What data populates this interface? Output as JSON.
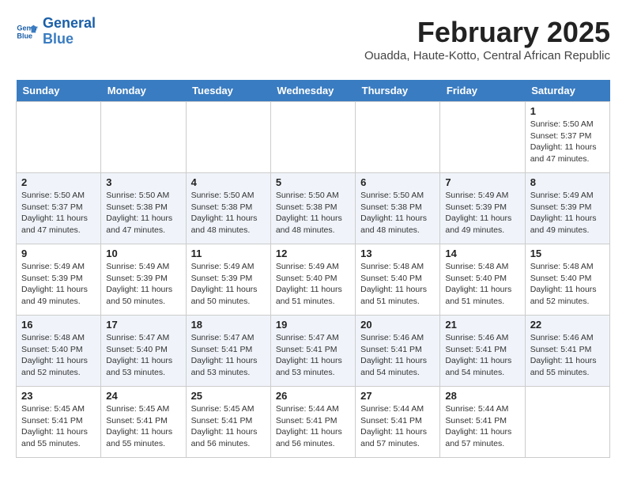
{
  "logo": {
    "line1": "General",
    "line2": "Blue"
  },
  "title": "February 2025",
  "subtitle": "Ouadda, Haute-Kotto, Central African Republic",
  "headers": [
    "Sunday",
    "Monday",
    "Tuesday",
    "Wednesday",
    "Thursday",
    "Friday",
    "Saturday"
  ],
  "weeks": [
    {
      "days": [
        {
          "number": "",
          "info": ""
        },
        {
          "number": "",
          "info": ""
        },
        {
          "number": "",
          "info": ""
        },
        {
          "number": "",
          "info": ""
        },
        {
          "number": "",
          "info": ""
        },
        {
          "number": "",
          "info": ""
        },
        {
          "number": "1",
          "info": "Sunrise: 5:50 AM\nSunset: 5:37 PM\nDaylight: 11 hours\nand 47 minutes."
        }
      ]
    },
    {
      "days": [
        {
          "number": "2",
          "info": "Sunrise: 5:50 AM\nSunset: 5:37 PM\nDaylight: 11 hours\nand 47 minutes."
        },
        {
          "number": "3",
          "info": "Sunrise: 5:50 AM\nSunset: 5:38 PM\nDaylight: 11 hours\nand 47 minutes."
        },
        {
          "number": "4",
          "info": "Sunrise: 5:50 AM\nSunset: 5:38 PM\nDaylight: 11 hours\nand 48 minutes."
        },
        {
          "number": "5",
          "info": "Sunrise: 5:50 AM\nSunset: 5:38 PM\nDaylight: 11 hours\nand 48 minutes."
        },
        {
          "number": "6",
          "info": "Sunrise: 5:50 AM\nSunset: 5:38 PM\nDaylight: 11 hours\nand 48 minutes."
        },
        {
          "number": "7",
          "info": "Sunrise: 5:49 AM\nSunset: 5:39 PM\nDaylight: 11 hours\nand 49 minutes."
        },
        {
          "number": "8",
          "info": "Sunrise: 5:49 AM\nSunset: 5:39 PM\nDaylight: 11 hours\nand 49 minutes."
        }
      ]
    },
    {
      "days": [
        {
          "number": "9",
          "info": "Sunrise: 5:49 AM\nSunset: 5:39 PM\nDaylight: 11 hours\nand 49 minutes."
        },
        {
          "number": "10",
          "info": "Sunrise: 5:49 AM\nSunset: 5:39 PM\nDaylight: 11 hours\nand 50 minutes."
        },
        {
          "number": "11",
          "info": "Sunrise: 5:49 AM\nSunset: 5:39 PM\nDaylight: 11 hours\nand 50 minutes."
        },
        {
          "number": "12",
          "info": "Sunrise: 5:49 AM\nSunset: 5:40 PM\nDaylight: 11 hours\nand 51 minutes."
        },
        {
          "number": "13",
          "info": "Sunrise: 5:48 AM\nSunset: 5:40 PM\nDaylight: 11 hours\nand 51 minutes."
        },
        {
          "number": "14",
          "info": "Sunrise: 5:48 AM\nSunset: 5:40 PM\nDaylight: 11 hours\nand 51 minutes."
        },
        {
          "number": "15",
          "info": "Sunrise: 5:48 AM\nSunset: 5:40 PM\nDaylight: 11 hours\nand 52 minutes."
        }
      ]
    },
    {
      "days": [
        {
          "number": "16",
          "info": "Sunrise: 5:48 AM\nSunset: 5:40 PM\nDaylight: 11 hours\nand 52 minutes."
        },
        {
          "number": "17",
          "info": "Sunrise: 5:47 AM\nSunset: 5:40 PM\nDaylight: 11 hours\nand 53 minutes."
        },
        {
          "number": "18",
          "info": "Sunrise: 5:47 AM\nSunset: 5:41 PM\nDaylight: 11 hours\nand 53 minutes."
        },
        {
          "number": "19",
          "info": "Sunrise: 5:47 AM\nSunset: 5:41 PM\nDaylight: 11 hours\nand 53 minutes."
        },
        {
          "number": "20",
          "info": "Sunrise: 5:46 AM\nSunset: 5:41 PM\nDaylight: 11 hours\nand 54 minutes."
        },
        {
          "number": "21",
          "info": "Sunrise: 5:46 AM\nSunset: 5:41 PM\nDaylight: 11 hours\nand 54 minutes."
        },
        {
          "number": "22",
          "info": "Sunrise: 5:46 AM\nSunset: 5:41 PM\nDaylight: 11 hours\nand 55 minutes."
        }
      ]
    },
    {
      "days": [
        {
          "number": "23",
          "info": "Sunrise: 5:45 AM\nSunset: 5:41 PM\nDaylight: 11 hours\nand 55 minutes."
        },
        {
          "number": "24",
          "info": "Sunrise: 5:45 AM\nSunset: 5:41 PM\nDaylight: 11 hours\nand 55 minutes."
        },
        {
          "number": "25",
          "info": "Sunrise: 5:45 AM\nSunset: 5:41 PM\nDaylight: 11 hours\nand 56 minutes."
        },
        {
          "number": "26",
          "info": "Sunrise: 5:44 AM\nSunset: 5:41 PM\nDaylight: 11 hours\nand 56 minutes."
        },
        {
          "number": "27",
          "info": "Sunrise: 5:44 AM\nSunset: 5:41 PM\nDaylight: 11 hours\nand 57 minutes."
        },
        {
          "number": "28",
          "info": "Sunrise: 5:44 AM\nSunset: 5:41 PM\nDaylight: 11 hours\nand 57 minutes."
        },
        {
          "number": "",
          "info": ""
        }
      ]
    }
  ]
}
